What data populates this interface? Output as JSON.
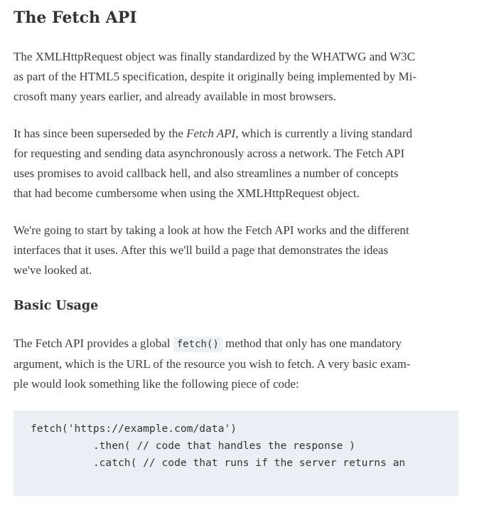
{
  "article": {
    "title": "The Fetch API",
    "intro": {
      "lines": [
        "The XMLHttpRequest object was finally standardized by the WHATWG and W3C",
        "as part of the HTML5 specification, despite it originally being implemented by Mi-",
        "crosoft many years earlier, and already available in most browsers."
      ]
    },
    "superseded": {
      "line1_before": "It has since been superseded by the ",
      "line1_emphasis": "Fetch API",
      "line1_after": ", which is currently a living standard",
      "lines": [
        "for requesting and sending data asynchronously across a network. The Fetch API",
        "uses promises to avoid callback hell, and also streamlines a number of concepts",
        "that had become cumbersome when using the XMLHttpRequest object."
      ]
    },
    "plan": {
      "lines": [
        "We're going to start by taking a look at how the Fetch API works and the different",
        "interfaces that it uses. After this we'll build a page that demonstrates the ideas",
        "we've looked at."
      ]
    },
    "basic_usage": {
      "heading": "Basic Usage",
      "line1_before": "The Fetch API provides a global ",
      "line1_code": "fetch()",
      "line1_after": " method that only has one mandatory",
      "lines": [
        "argument, which is the URL of the resource you wish to fetch. A very basic exam-",
        "ple would look something like the following piece of code:"
      ]
    },
    "code_sample": {
      "lines": [
        "fetch('https://example.com/data')",
        "          .then( // code that handles the response )",
        "          .catch( // code that runs if the server returns an"
      ]
    }
  }
}
